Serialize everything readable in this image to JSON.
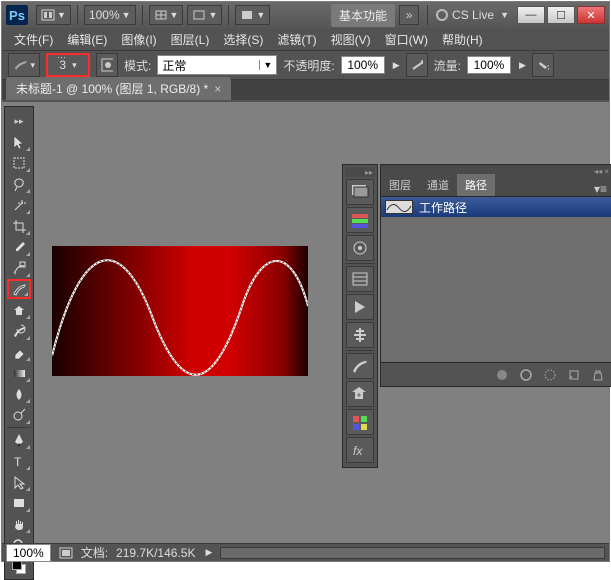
{
  "app": {
    "logo": "Ps",
    "workspace_label": "基本功能",
    "cs_live": "CS Live"
  },
  "menus": [
    "文件(F)",
    "编辑(E)",
    "图像(I)",
    "图层(L)",
    "选择(S)",
    "滤镜(T)",
    "视图(V)",
    "窗口(W)",
    "帮助(H)"
  ],
  "options": {
    "zoom_combo": "100%",
    "brush_size": "3",
    "mode_label": "模式:",
    "mode_value": "正常",
    "opacity_label": "不透明度:",
    "opacity_value": "100%",
    "flow_label": "流量:",
    "flow_value": "100%"
  },
  "document": {
    "tab_title": "未标题-1 @ 100% (图层 1, RGB/8) *"
  },
  "panels": {
    "tabs": [
      "图层",
      "通道",
      "路径"
    ],
    "active_tab": 2,
    "path_row": "工作路径"
  },
  "status": {
    "zoom": "100%",
    "doc_label": "文档:",
    "doc_value": "219.7K/146.5K"
  },
  "tools": [
    "move-tool",
    "marquee-tool",
    "lasso-tool",
    "magic-wand-tool",
    "crop-tool",
    "eyedropper-tool",
    "healing-brush-tool",
    "brush-tool",
    "clone-stamp-tool",
    "history-brush-tool",
    "eraser-tool",
    "gradient-tool",
    "blur-tool",
    "dodge-tool",
    "pen-tool",
    "type-tool",
    "path-select-tool",
    "shape-tool",
    "hand-tool",
    "zoom-tool"
  ],
  "mini_tools": [
    "layers-icon",
    "channels-icon",
    "paths-icon",
    "history-icon",
    "actions-icon",
    "adjustments-icon",
    "brush-preset-icon",
    "clone-source-icon",
    "swatches-icon",
    "styles-icon"
  ],
  "panel_foot_icons": [
    "fill-path-icon",
    "stroke-path-icon",
    "selection-icon",
    "new-path-icon",
    "delete-icon"
  ]
}
